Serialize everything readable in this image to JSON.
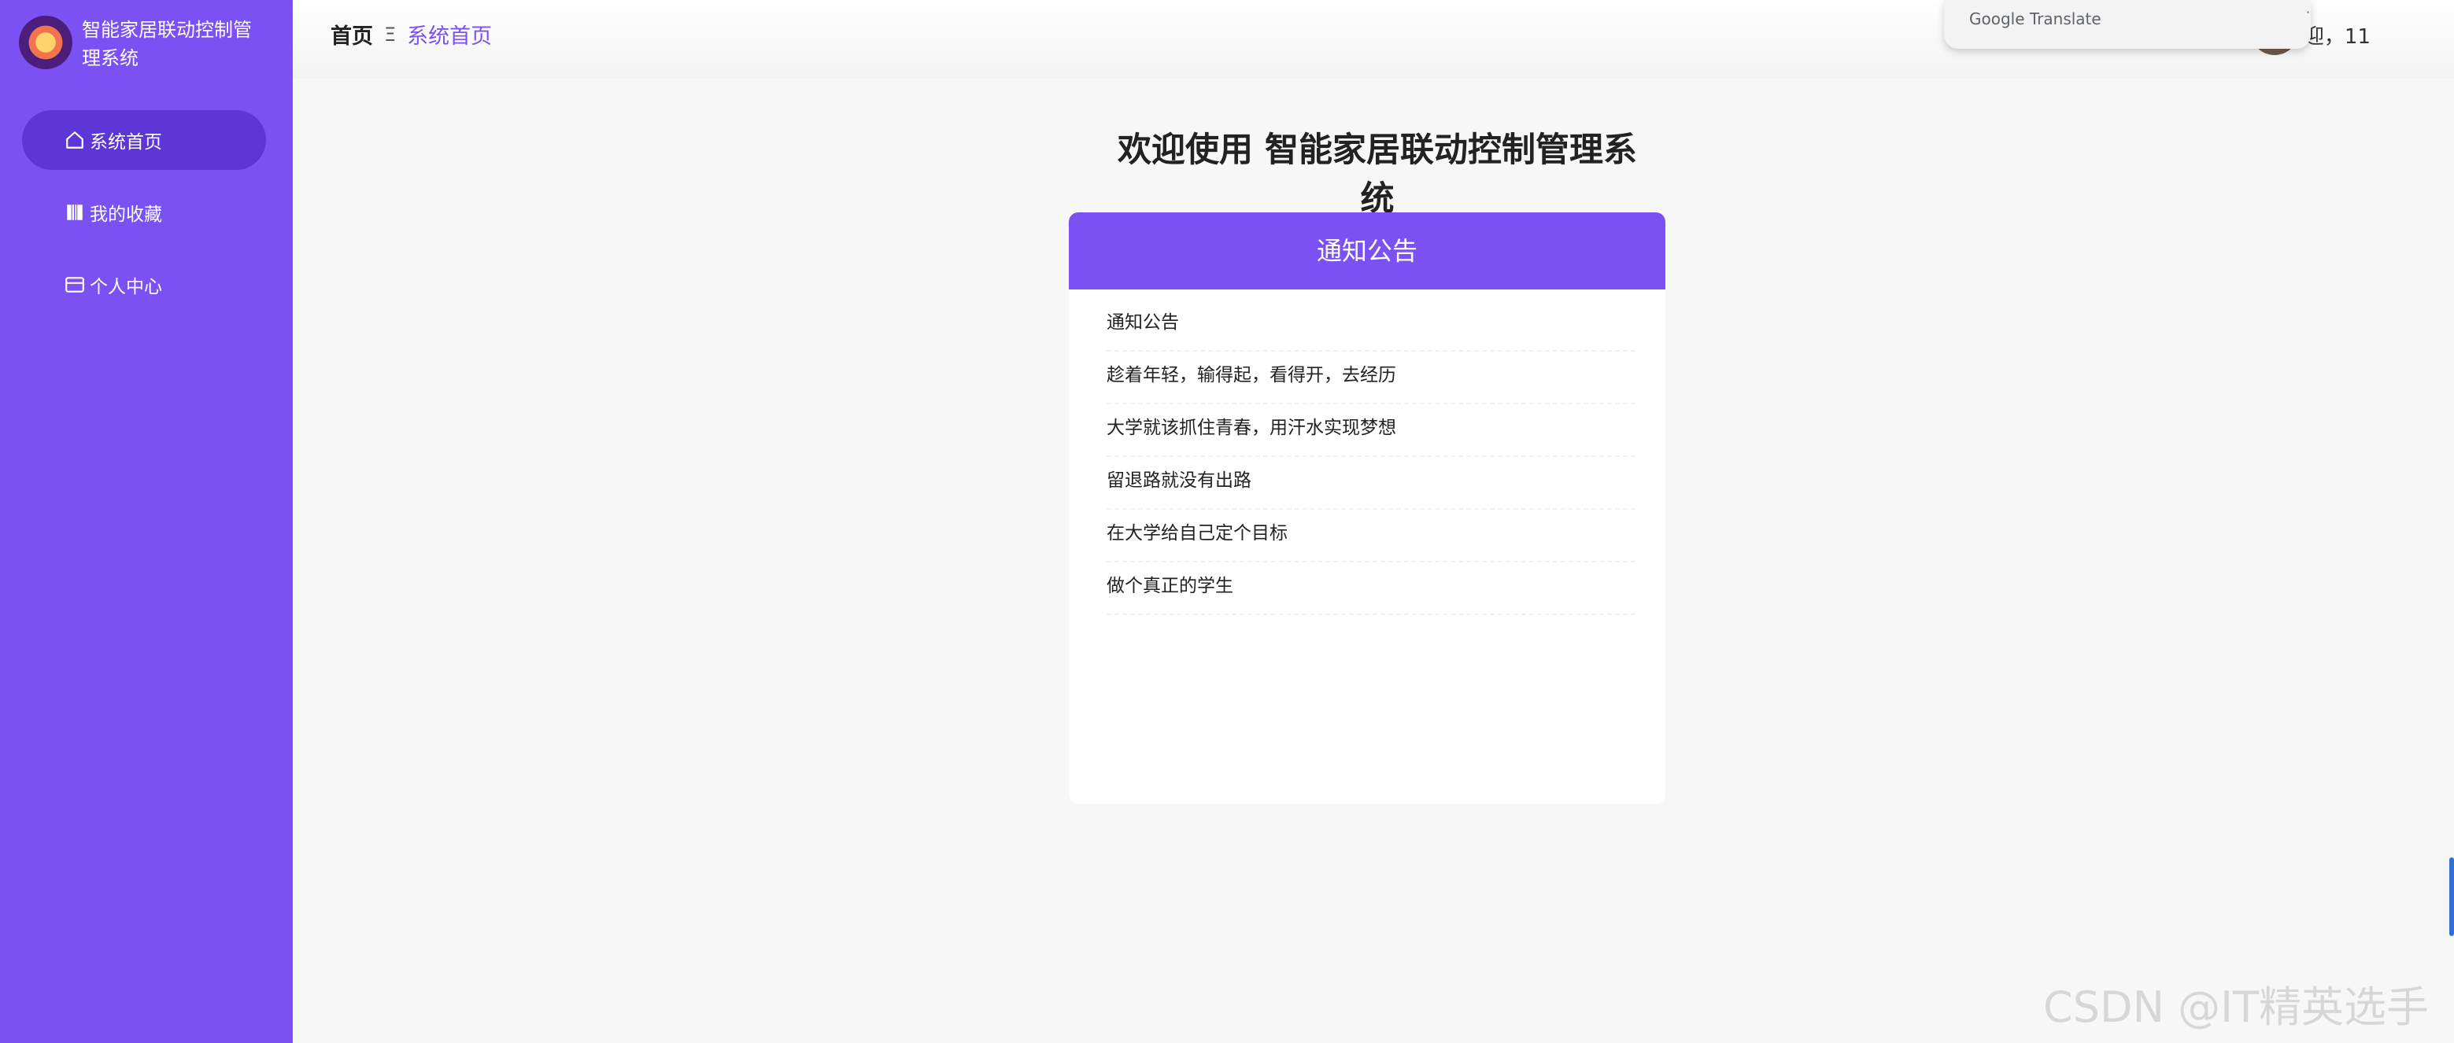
{
  "sidebar": {
    "brand_title": "智能家居联动控制管理系统",
    "items": [
      {
        "label": "系统首页",
        "icon": "home-icon",
        "active": true
      },
      {
        "label": "我的收藏",
        "icon": "bookmark-icon",
        "active": false
      },
      {
        "label": "个人中心",
        "icon": "card-icon",
        "active": false
      }
    ]
  },
  "header": {
    "crumb_home": "首页",
    "crumb_separator": "Ξ",
    "crumb_current": "系统首页",
    "welcome_text": "迎，11"
  },
  "translate_popup": {
    "label": "Google Translate",
    "dot": "·"
  },
  "main": {
    "title": "欢迎使用 智能家居联动控制管理系统",
    "notice": {
      "header": "通知公告",
      "items": [
        "通知公告",
        "趁着年轻，输得起，看得开，去经历",
        "大学就该抓住青春，用汗水实现梦想",
        "留退路就没有出路",
        "在大学给自己定个目标",
        "做个真正的学生"
      ]
    }
  },
  "watermark": "CSDN @IT精英选手",
  "colors": {
    "accent": "#7c51f3",
    "accent_dark": "#5e35d6",
    "background": "#f7f7f7"
  }
}
